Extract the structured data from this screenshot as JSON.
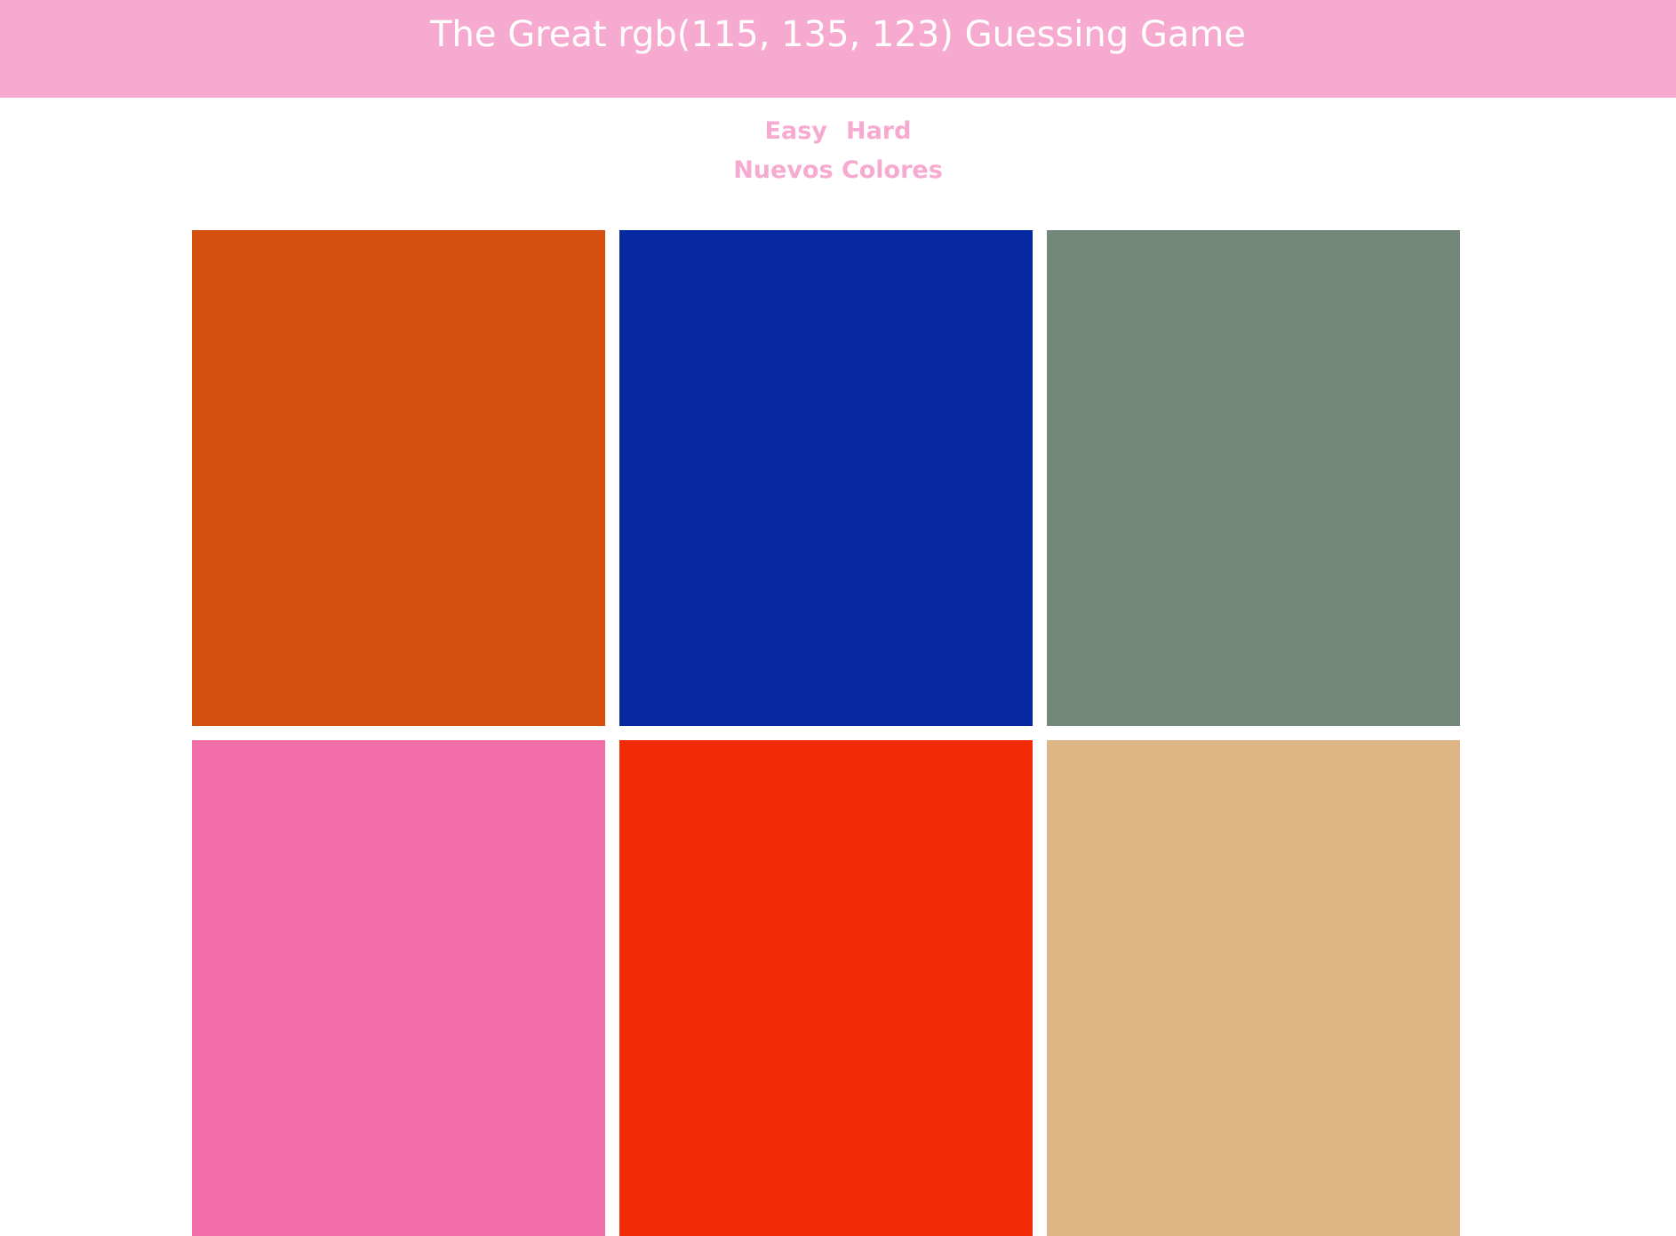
{
  "header": {
    "title": "The Great rgb(115, 135, 123) Guessing Game",
    "background": "#f7aacf"
  },
  "controls": {
    "easy_label": "Easy",
    "hard_label": "Hard",
    "new_colors_label": "Nuevos Colores",
    "accent": "#f7aacf"
  },
  "squares": [
    {
      "color": "#d5500f"
    },
    {
      "color": "#0629a0"
    },
    {
      "color": "#73887b"
    },
    {
      "color": "#f16ea8"
    },
    {
      "color": "#f22a06"
    },
    {
      "color": "#deb686"
    }
  ]
}
